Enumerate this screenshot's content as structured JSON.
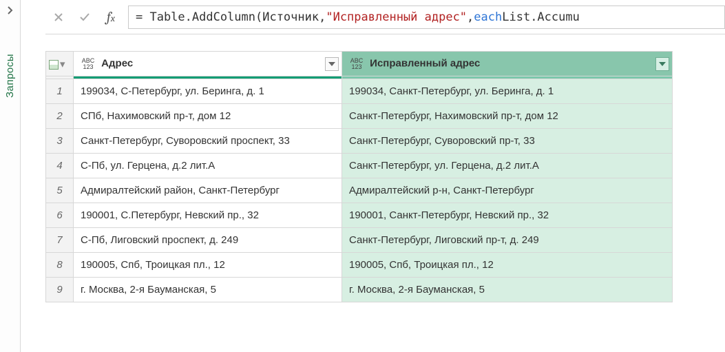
{
  "sidebar": {
    "label": "Запросы"
  },
  "formula": {
    "prefix": "= Table.AddColumn(Источник, ",
    "string_literal": "\"Исправленный адрес\"",
    "mid": ", ",
    "keyword_each": "each",
    "suffix": " List.Accumu"
  },
  "columns": [
    {
      "name": "Адрес",
      "type_label_top": "ABC",
      "type_label_bot": "123"
    },
    {
      "name": "Исправленный адрес",
      "type_label_top": "ABC",
      "type_label_bot": "123"
    }
  ],
  "rows": [
    {
      "n": "1",
      "a": "199034, С-Петербург, ул. Беринга, д. 1",
      "b": "199034, Санкт-Петербург, ул. Беринга, д. 1"
    },
    {
      "n": "2",
      "a": "СПб, Нахимовский пр-т, дом 12",
      "b": "Санкт-Петербург, Нахимовский пр-т, дом 12"
    },
    {
      "n": "3",
      "a": "Санкт-Петербург, Суворовский проспект, 33",
      "b": "Санкт-Петербург, Суворовский пр-т, 33"
    },
    {
      "n": "4",
      "a": "С-Пб, ул. Герцена, д.2 лит.А",
      "b": "Санкт-Петербург, ул. Герцена, д.2 лит.А"
    },
    {
      "n": "5",
      "a": "Адмиралтейский район, Санкт-Петербург",
      "b": "Адмиралтейский р-н, Санкт-Петербург"
    },
    {
      "n": "6",
      "a": "190001, С.Петербург, Невский пр., 32",
      "b": "190001, Санкт-Петербург, Невский пр., 32"
    },
    {
      "n": "7",
      "a": "С-Пб, Лиговский проспект, д. 249",
      "b": "Санкт-Петербург, Лиговский пр-т, д. 249"
    },
    {
      "n": "8",
      "a": "190005, Спб, Троицкая пл., 12",
      "b": "190005, Спб, Троицкая пл., 12"
    },
    {
      "n": "9",
      "a": "г. Москва, 2-я Бауманская, 5",
      "b": "г. Москва, 2-я Бауманская, 5"
    }
  ]
}
